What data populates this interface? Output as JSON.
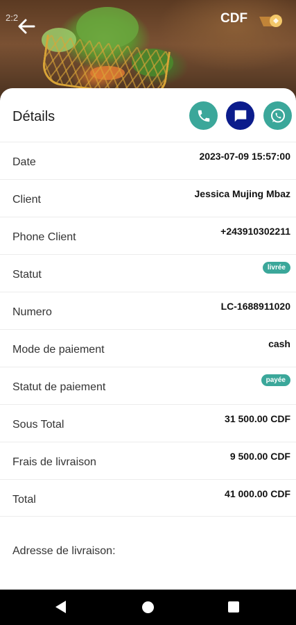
{
  "header": {
    "status_time": "2:2",
    "currency": "CDF",
    "back_icon": "arrow-left-icon",
    "cart_icon": "cart-icon"
  },
  "card": {
    "title": "Détails",
    "actions": [
      {
        "icon": "phone-icon",
        "color": "#3ba79a"
      },
      {
        "icon": "message-icon",
        "color": "#0b1c8c"
      },
      {
        "icon": "whatsapp-icon",
        "color": "#3ba79a"
      }
    ]
  },
  "details": [
    {
      "label": "Date",
      "value": "2023-07-09 15:57:00"
    },
    {
      "label": "Client",
      "value": "Jessica Mujing Mbaz"
    },
    {
      "label": "Phone Client",
      "value": "+243910302211"
    },
    {
      "label": "Statut",
      "badge": "livrée"
    },
    {
      "label": "Numero",
      "value": "LC-1688911020"
    },
    {
      "label": "Mode de paiement",
      "value": "cash"
    },
    {
      "label": "Statut de paiement",
      "badge": "payée"
    },
    {
      "label": "Sous Total",
      "value": "31 500.00 CDF"
    },
    {
      "label": "Frais de livraison",
      "value": "9 500.00 CDF"
    },
    {
      "label": "Total",
      "value": "41 000.00 CDF"
    }
  ],
  "address": {
    "label": "Adresse de livraison:"
  },
  "colors": {
    "accent": "#3ba79a",
    "sms": "#0b1c8c"
  }
}
